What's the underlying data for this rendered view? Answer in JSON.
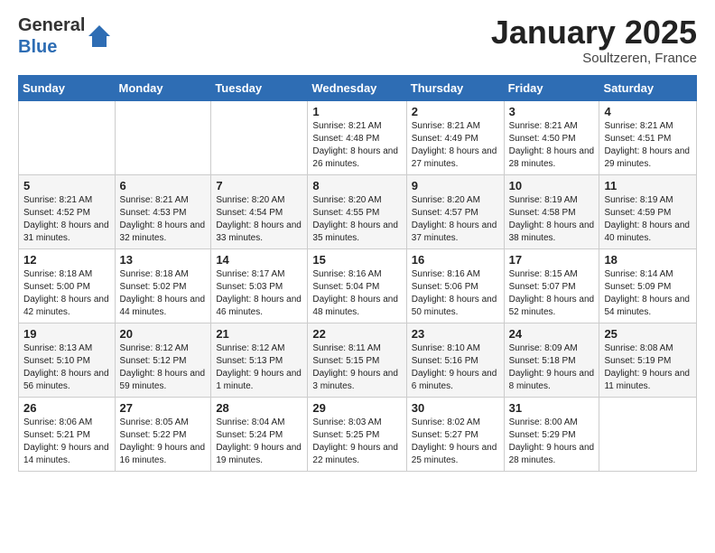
{
  "logo": {
    "general": "General",
    "blue": "Blue"
  },
  "title": "January 2025",
  "subtitle": "Soultzeren, France",
  "days_header": [
    "Sunday",
    "Monday",
    "Tuesday",
    "Wednesday",
    "Thursday",
    "Friday",
    "Saturday"
  ],
  "weeks": [
    [
      {
        "num": "",
        "info": ""
      },
      {
        "num": "",
        "info": ""
      },
      {
        "num": "",
        "info": ""
      },
      {
        "num": "1",
        "info": "Sunrise: 8:21 AM\nSunset: 4:48 PM\nDaylight: 8 hours and 26 minutes."
      },
      {
        "num": "2",
        "info": "Sunrise: 8:21 AM\nSunset: 4:49 PM\nDaylight: 8 hours and 27 minutes."
      },
      {
        "num": "3",
        "info": "Sunrise: 8:21 AM\nSunset: 4:50 PM\nDaylight: 8 hours and 28 minutes."
      },
      {
        "num": "4",
        "info": "Sunrise: 8:21 AM\nSunset: 4:51 PM\nDaylight: 8 hours and 29 minutes."
      }
    ],
    [
      {
        "num": "5",
        "info": "Sunrise: 8:21 AM\nSunset: 4:52 PM\nDaylight: 8 hours and 31 minutes."
      },
      {
        "num": "6",
        "info": "Sunrise: 8:21 AM\nSunset: 4:53 PM\nDaylight: 8 hours and 32 minutes."
      },
      {
        "num": "7",
        "info": "Sunrise: 8:20 AM\nSunset: 4:54 PM\nDaylight: 8 hours and 33 minutes."
      },
      {
        "num": "8",
        "info": "Sunrise: 8:20 AM\nSunset: 4:55 PM\nDaylight: 8 hours and 35 minutes."
      },
      {
        "num": "9",
        "info": "Sunrise: 8:20 AM\nSunset: 4:57 PM\nDaylight: 8 hours and 37 minutes."
      },
      {
        "num": "10",
        "info": "Sunrise: 8:19 AM\nSunset: 4:58 PM\nDaylight: 8 hours and 38 minutes."
      },
      {
        "num": "11",
        "info": "Sunrise: 8:19 AM\nSunset: 4:59 PM\nDaylight: 8 hours and 40 minutes."
      }
    ],
    [
      {
        "num": "12",
        "info": "Sunrise: 8:18 AM\nSunset: 5:00 PM\nDaylight: 8 hours and 42 minutes."
      },
      {
        "num": "13",
        "info": "Sunrise: 8:18 AM\nSunset: 5:02 PM\nDaylight: 8 hours and 44 minutes."
      },
      {
        "num": "14",
        "info": "Sunrise: 8:17 AM\nSunset: 5:03 PM\nDaylight: 8 hours and 46 minutes."
      },
      {
        "num": "15",
        "info": "Sunrise: 8:16 AM\nSunset: 5:04 PM\nDaylight: 8 hours and 48 minutes."
      },
      {
        "num": "16",
        "info": "Sunrise: 8:16 AM\nSunset: 5:06 PM\nDaylight: 8 hours and 50 minutes."
      },
      {
        "num": "17",
        "info": "Sunrise: 8:15 AM\nSunset: 5:07 PM\nDaylight: 8 hours and 52 minutes."
      },
      {
        "num": "18",
        "info": "Sunrise: 8:14 AM\nSunset: 5:09 PM\nDaylight: 8 hours and 54 minutes."
      }
    ],
    [
      {
        "num": "19",
        "info": "Sunrise: 8:13 AM\nSunset: 5:10 PM\nDaylight: 8 hours and 56 minutes."
      },
      {
        "num": "20",
        "info": "Sunrise: 8:12 AM\nSunset: 5:12 PM\nDaylight: 8 hours and 59 minutes."
      },
      {
        "num": "21",
        "info": "Sunrise: 8:12 AM\nSunset: 5:13 PM\nDaylight: 9 hours and 1 minute."
      },
      {
        "num": "22",
        "info": "Sunrise: 8:11 AM\nSunset: 5:15 PM\nDaylight: 9 hours and 3 minutes."
      },
      {
        "num": "23",
        "info": "Sunrise: 8:10 AM\nSunset: 5:16 PM\nDaylight: 9 hours and 6 minutes."
      },
      {
        "num": "24",
        "info": "Sunrise: 8:09 AM\nSunset: 5:18 PM\nDaylight: 9 hours and 8 minutes."
      },
      {
        "num": "25",
        "info": "Sunrise: 8:08 AM\nSunset: 5:19 PM\nDaylight: 9 hours and 11 minutes."
      }
    ],
    [
      {
        "num": "26",
        "info": "Sunrise: 8:06 AM\nSunset: 5:21 PM\nDaylight: 9 hours and 14 minutes."
      },
      {
        "num": "27",
        "info": "Sunrise: 8:05 AM\nSunset: 5:22 PM\nDaylight: 9 hours and 16 minutes."
      },
      {
        "num": "28",
        "info": "Sunrise: 8:04 AM\nSunset: 5:24 PM\nDaylight: 9 hours and 19 minutes."
      },
      {
        "num": "29",
        "info": "Sunrise: 8:03 AM\nSunset: 5:25 PM\nDaylight: 9 hours and 22 minutes."
      },
      {
        "num": "30",
        "info": "Sunrise: 8:02 AM\nSunset: 5:27 PM\nDaylight: 9 hours and 25 minutes."
      },
      {
        "num": "31",
        "info": "Sunrise: 8:00 AM\nSunset: 5:29 PM\nDaylight: 9 hours and 28 minutes."
      },
      {
        "num": "",
        "info": ""
      }
    ]
  ]
}
